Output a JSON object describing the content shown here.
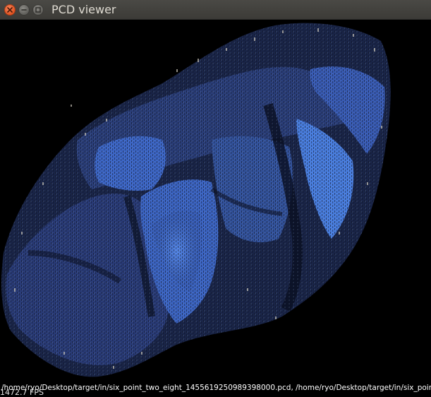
{
  "window": {
    "title": "PCD viewer",
    "buttons": {
      "close_icon": "close-icon",
      "minimize_icon": "minimize-icon",
      "maximize_icon": "maximize-icon"
    }
  },
  "viewer": {
    "background_color": "#000000",
    "cloud_colors": {
      "dark_blue": "#1e2f5e",
      "mid_blue": "#3a5fb0",
      "bright_blue": "#4a82e0",
      "highlight": "#c9c4b8"
    },
    "file_info": "/home/ryo/Desktop/target/in/six_point_two_eight_1455619250989398000.pcd, /home/ryo/Desktop/target/in/six_point_two_e",
    "fps": "1472.7 FPS"
  }
}
